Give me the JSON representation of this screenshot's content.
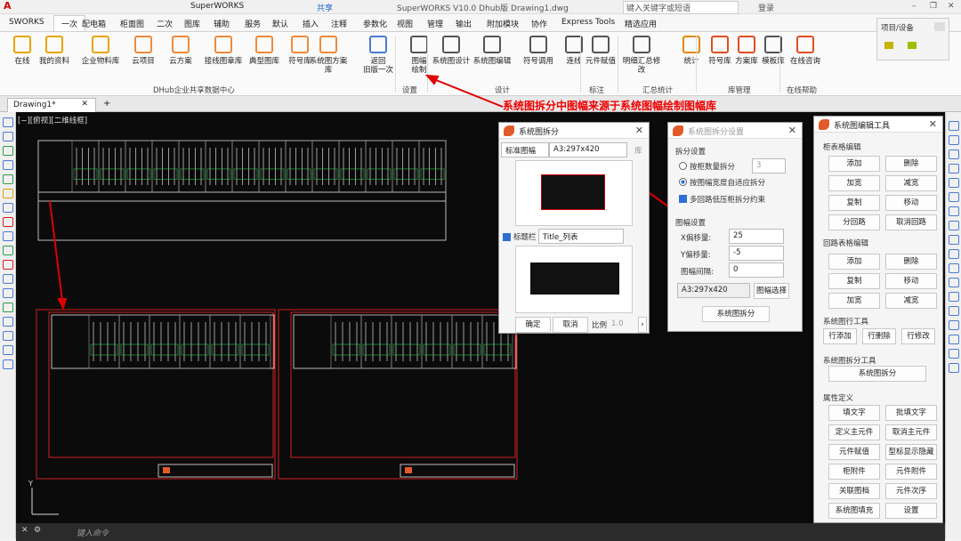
{
  "title_bar": {
    "app_name": "SuperWORKS",
    "share_label": "共享",
    "window_title": "SuperWORKS V10.0 Dhub版   Drawing1.dwg",
    "search_placeholder": "键入关键字或短语",
    "login_label": "登录"
  },
  "menu": [
    "SWORKS",
    "一次",
    "配电箱",
    "柜面图",
    "二次",
    "图库",
    "辅助",
    "服务",
    "默认",
    "插入",
    "注释",
    "参数化",
    "视图",
    "管理",
    "输出",
    "附加模块",
    "协作",
    "Express Tools",
    "精选应用"
  ],
  "ribbon": {
    "buttons": [
      {
        "label": "在线"
      },
      {
        "label": "我的资料"
      },
      {
        "label": "企业物料库"
      },
      {
        "label": "云项目"
      },
      {
        "label": "云方案"
      },
      {
        "label": "接线图章库"
      },
      {
        "label": "典型图库"
      },
      {
        "label": "符号库"
      },
      {
        "label": "系统图方案库"
      },
      {
        "label": "返回\n旧版一次"
      },
      {
        "label": "图幅\n绘制"
      },
      {
        "label": "系统图设计"
      },
      {
        "label": "系统图编辑"
      },
      {
        "label": "符号调用"
      },
      {
        "label": "连线"
      },
      {
        "label": "元件赋值"
      },
      {
        "label": "明细汇总修改"
      },
      {
        "label": "统计"
      },
      {
        "label": "符号库"
      },
      {
        "label": "方案库"
      },
      {
        "label": "模板库"
      },
      {
        "label": "在线咨询"
      }
    ],
    "groups": [
      "DHub企业共享数据中心",
      "设置",
      "设计",
      "标注",
      "汇总统计",
      "库管理",
      "在线帮助"
    ]
  },
  "project_panel": {
    "title": "项目/设备"
  },
  "doc_tab": {
    "name": "Drawing1*",
    "close": "✕",
    "add": "+"
  },
  "viewport_label": "[−][俯视][二维线框]",
  "annotation": "系统图拆分中图幅来源于系统图幅绘制图幅库",
  "split_dialog": {
    "title": "系统图拆分",
    "frame_source": "标准图幅",
    "frame_size": "A3:297x420",
    "lib_label": "库",
    "titlebar_label": "标题栏",
    "titlebar_value": "Title_列表",
    "ok": "确定",
    "cancel": "取消",
    "scale_label": "比例",
    "scale_value": "1.0"
  },
  "settings_dialog": {
    "title": "系统图拆分设置",
    "split_settings": "拆分设置",
    "by_cabinet_count": "按柜数量拆分",
    "cabinet_count_value": "3",
    "by_frame_width": "按图幅宽度自适应拆分",
    "multi_loop_constraint": "多回路低压柜拆分约束",
    "frame_settings": "图幅设置",
    "x_offset_label": "X偏移量:",
    "x_offset_value": "25",
    "y_offset_label": "Y偏移量:",
    "y_offset_value": "-5",
    "frame_gap_label": "图幅间隔:",
    "frame_gap_value": "0",
    "frame_current": "A3:297x420",
    "frame_select": "图幅选择",
    "split_button": "系统图拆分"
  },
  "edit_tool": {
    "title": "系统图编辑工具",
    "cabinet_table_edit": "柜表格编辑",
    "cabinet_buttons": [
      "添加",
      "删除",
      "加宽",
      "减宽",
      "复制",
      "移动",
      "分回路",
      "取消回路"
    ],
    "loop_table_edit": "回路表格编辑",
    "loop_buttons": [
      "添加",
      "删除",
      "复制",
      "移动",
      "加宽",
      "减宽"
    ],
    "row_tools": "系统图行工具",
    "row_buttons": [
      "行添加",
      "行删除",
      "行修改"
    ],
    "split_tools": "系统图拆分工具",
    "split_button": "系统图拆分",
    "attr_def": "属性定义",
    "attr_buttons": [
      "填文字",
      "批填文字",
      "定义主元件",
      "取消主元件",
      "元件赋值",
      "型标显示隐藏",
      "柜附件",
      "元件附件",
      "关联图档",
      "元件次序",
      "系统图填充",
      "设置"
    ]
  },
  "command_placeholder": "键入命令",
  "colors": {
    "accent_red": "#e00000",
    "logo_orange": "#e25a2a",
    "canvas": "#0b0b0b",
    "highlight_box": "#d02020"
  }
}
